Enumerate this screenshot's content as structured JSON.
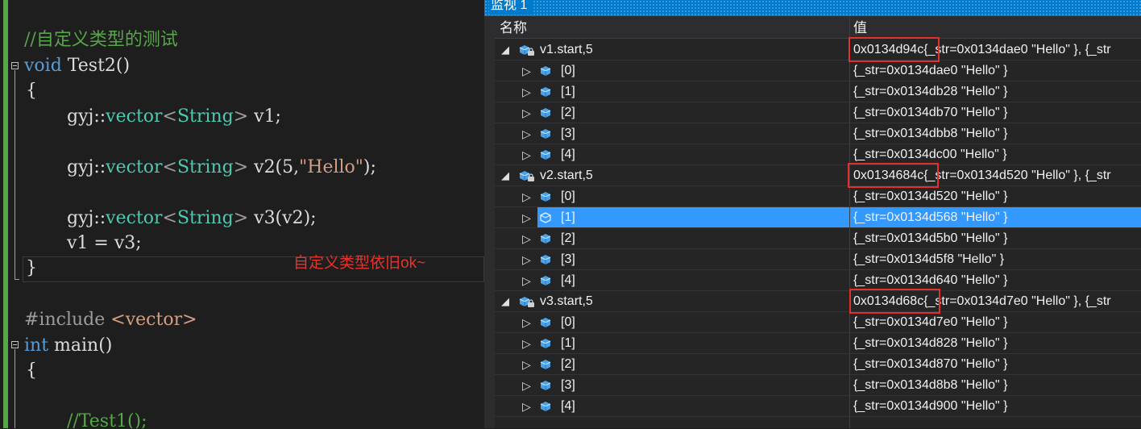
{
  "editor": {
    "comment1": "//自定义类型的测试",
    "kw_void": "void",
    "func_test2": " Test2()",
    "brace_open": "{",
    "brace_close": "}",
    "ns": "gyj::",
    "vector_kw": "vector",
    "lt": "<",
    "string_type": "String",
    "gt": ">",
    "decl1_rest": " v1;",
    "decl2_rest": " v2(5,",
    "hello_str": "\"Hello\"",
    "decl2_end": ");",
    "decl3_rest": " v3(v2);",
    "assign": "v1 = v3;",
    "include_kw": "#include",
    "include_file": " <vector>",
    "kw_int": "int",
    "func_main": " main()",
    "comment2": "//Test1();",
    "annotation": "自定义类型依旧ok~"
  },
  "watch": {
    "title": "监视 1",
    "col_name": "名称",
    "col_value": "值",
    "groups": [
      {
        "name": "v1.start,5",
        "addr": "0x0134d94c",
        "value_rest": "{_str=0x0134dae0 \"Hello\" }, {_str",
        "items": [
          {
            "idx": "[0]",
            "val": "{_str=0x0134dae0 \"Hello\" }"
          },
          {
            "idx": "[1]",
            "val": "{_str=0x0134db28 \"Hello\" }"
          },
          {
            "idx": "[2]",
            "val": "{_str=0x0134db70 \"Hello\" }"
          },
          {
            "idx": "[3]",
            "val": "{_str=0x0134dbb8 \"Hello\" }"
          },
          {
            "idx": "[4]",
            "val": "{_str=0x0134dc00 \"Hello\" }"
          }
        ]
      },
      {
        "name": "v2.start,5",
        "addr": "0x0134684c",
        "value_rest": "{_str=0x0134d520 \"Hello\" }, {_str",
        "items": [
          {
            "idx": "[0]",
            "val": "{_str=0x0134d520 \"Hello\" }"
          },
          {
            "idx": "[1]",
            "val": "{_str=0x0134d568 \"Hello\" }"
          },
          {
            "idx": "[2]",
            "val": "{_str=0x0134d5b0 \"Hello\" }"
          },
          {
            "idx": "[3]",
            "val": "{_str=0x0134d5f8 \"Hello\" }"
          },
          {
            "idx": "[4]",
            "val": "{_str=0x0134d640 \"Hello\" }"
          }
        ]
      },
      {
        "name": "v3.start,5",
        "addr": "0x0134d68c",
        "value_rest": "{_str=0x0134d7e0 \"Hello\" }, {_str",
        "items": [
          {
            "idx": "[0]",
            "val": "{_str=0x0134d7e0 \"Hello\" }"
          },
          {
            "idx": "[1]",
            "val": "{_str=0x0134d828 \"Hello\" }"
          },
          {
            "idx": "[2]",
            "val": "{_str=0x0134d870 \"Hello\" }"
          },
          {
            "idx": "[3]",
            "val": "{_str=0x0134d8b8 \"Hello\" }"
          },
          {
            "idx": "[4]",
            "val": "{_str=0x0134d900 \"Hello\" }"
          }
        ]
      }
    ]
  },
  "colors": {
    "highlight_box": "#e0312b",
    "selection": "#3399ff",
    "title_bar": "#007acc"
  }
}
